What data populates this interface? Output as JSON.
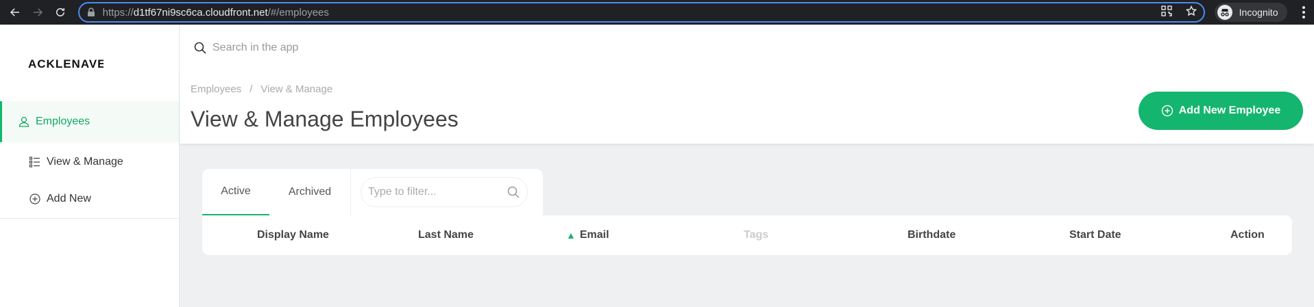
{
  "browser": {
    "url_scheme": "https://",
    "url_host": "d1tf67ni9sc6ca.cloudfront.net",
    "url_path": "/#/employees",
    "incognito_label": "Incognito"
  },
  "sidebar": {
    "logo": "ACKLENAVENUE",
    "items": [
      {
        "label": "Employees"
      },
      {
        "label": "View & Manage"
      },
      {
        "label": "Add New"
      }
    ]
  },
  "search": {
    "placeholder": "Search in the app"
  },
  "breadcrumb": {
    "root": "Employees",
    "separator": "/",
    "current": "View & Manage"
  },
  "page": {
    "title": "View & Manage Employees",
    "add_button": "Add New Employee"
  },
  "tabs": {
    "active": "Active",
    "archived": "Archived",
    "filter_placeholder": "Type to filter..."
  },
  "table": {
    "columns": [
      "Display Name",
      "Last Name",
      "Email",
      "Tags",
      "Birthdate",
      "Start Date",
      "Action"
    ],
    "sorted_column": "Email",
    "sort_indicator": "▲"
  },
  "colors": {
    "accent": "#14b56e"
  }
}
